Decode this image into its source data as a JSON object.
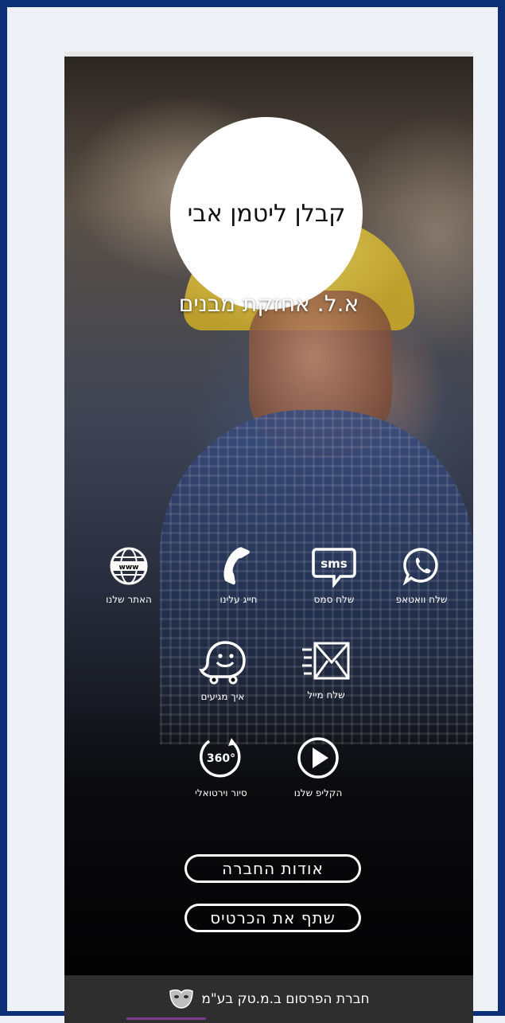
{
  "card": {
    "logo_text": "קבלן ליטמן אבי",
    "subtitle": "א.ל. אחזקת מבנים"
  },
  "actions": [
    {
      "label": "שלח וואטאפ",
      "icon": "whatsapp-icon"
    },
    {
      "label": "שלח סמס",
      "icon": "sms-icon",
      "icon_text": "sms"
    },
    {
      "label": "חייג עלינו",
      "icon": "phone-icon"
    },
    {
      "label": "האתר שלנו",
      "icon": "globe-icon",
      "icon_text": "www"
    },
    {
      "label": "שלח מייל",
      "icon": "mail-icon"
    },
    {
      "label": "איך מגיעים",
      "icon": "waze-icon"
    },
    {
      "label": "הקליפ שלנו",
      "icon": "play-icon"
    },
    {
      "label": "סיור וירטואלי",
      "icon": "360-icon",
      "icon_text": "360°"
    }
  ],
  "buttons": {
    "about": "אודות החברה",
    "share": "שתף את הכרטיס"
  },
  "footer": {
    "text": "חברת הפרסום ב.מ.טק בע\"מ"
  }
}
